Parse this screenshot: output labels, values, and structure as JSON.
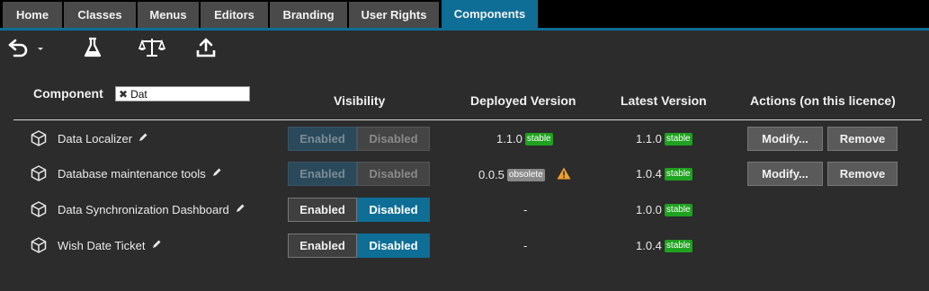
{
  "nav": {
    "tabs": [
      {
        "label": "Home"
      },
      {
        "label": "Classes"
      },
      {
        "label": "Menus"
      },
      {
        "label": "Editors"
      },
      {
        "label": "Branding"
      },
      {
        "label": "User Rights"
      },
      {
        "label": "Components"
      }
    ],
    "active_tab": "Components"
  },
  "toolbar": {
    "icons": [
      "undo-icon",
      "dropdown-caret-icon",
      "flask-icon",
      "scale-icon",
      "upload-icon"
    ]
  },
  "table": {
    "headers": {
      "component": "Component",
      "visibility": "Visibility",
      "deployed": "Deployed Version",
      "latest": "Latest Version",
      "actions": "Actions (on this licence)"
    },
    "filter": {
      "value": "Dat",
      "clear_glyph": "✖"
    },
    "rows": [
      {
        "name": "Data Localizer",
        "enabled_label": "Enabled",
        "disabled_label": "Disabled",
        "deployed_version": "1.1.0",
        "deployed_badge": "stable",
        "latest_version": "1.1.0",
        "latest_badge": "stable",
        "modify_label": "Modify...",
        "remove_label": "Remove"
      },
      {
        "name": "Database maintenance tools",
        "enabled_label": "Enabled",
        "disabled_label": "Disabled",
        "deployed_version": "0.0.5",
        "deployed_badge": "obsolete",
        "latest_version": "1.0.4",
        "latest_badge": "stable",
        "modify_label": "Modify...",
        "remove_label": "Remove"
      },
      {
        "name": "Data Synchronization Dashboard",
        "enabled_label": "Enabled",
        "disabled_label": "Disabled",
        "deployed_version": "-",
        "latest_version": "1.0.0",
        "latest_badge": "stable"
      },
      {
        "name": "Wish Date Ticket",
        "enabled_label": "Enabled",
        "disabled_label": "Disabled",
        "deployed_version": "-",
        "latest_version": "1.0.4",
        "latest_badge": "stable"
      }
    ]
  },
  "colors": {
    "accent": "#0e6e96",
    "stable": "#1fa21f",
    "obsolete": "#888888",
    "warning": "#f0a030"
  }
}
